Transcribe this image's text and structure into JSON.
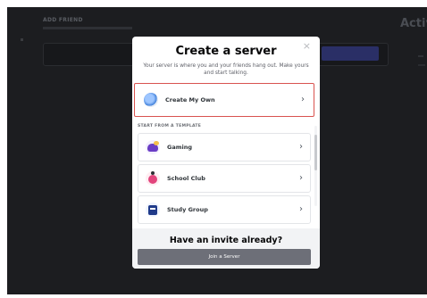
{
  "background": {
    "heading": "ADD FRIEND",
    "active_label": "Activ"
  },
  "modal": {
    "close_glyph": "×",
    "title": "Create a server",
    "subtitle": "Your server is where you and your friends hang out. Make yours and start talking.",
    "create_own": {
      "label": "Create My Own",
      "icon": "globe-icon"
    },
    "section_label": "START FROM A TEMPLATE",
    "templates": [
      {
        "label": "Gaming",
        "icon": "gaming-icon"
      },
      {
        "label": "School Club",
        "icon": "school-club-icon"
      },
      {
        "label": "Study Group",
        "icon": "study-group-icon"
      }
    ],
    "chevron": "›",
    "footer": {
      "invite_text": "Have an invite already?",
      "join_label": "Join a Server"
    }
  },
  "colors": {
    "highlight": "#d9534f",
    "join_button": "#6d6f78",
    "backdrop": "#1c1d20"
  }
}
